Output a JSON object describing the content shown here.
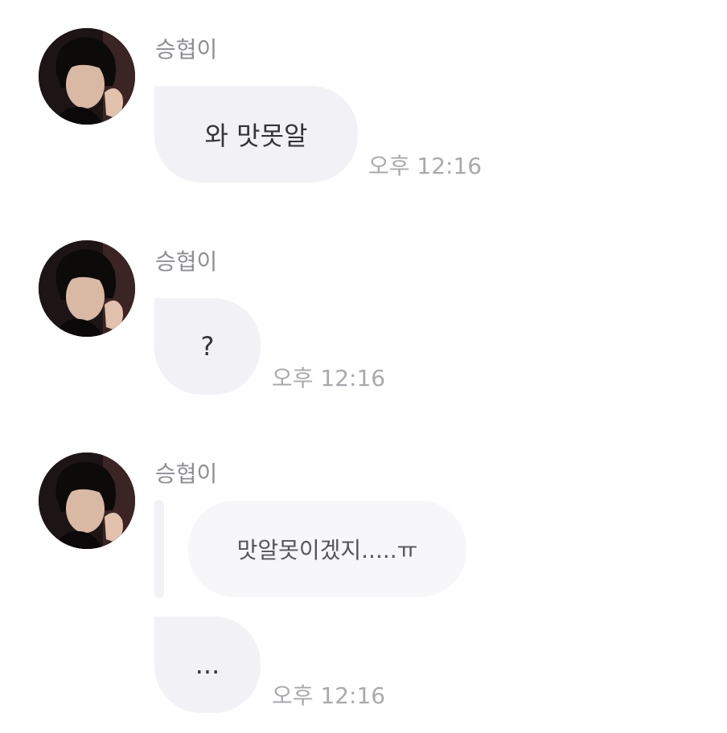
{
  "messages": [
    {
      "sender": "승협이",
      "text": "와 맛못알",
      "time": "오후 12:16"
    },
    {
      "sender": "승협이",
      "text": "?",
      "time": "오후 12:16"
    },
    {
      "sender": "승협이",
      "quoted_text": "맛알못이겠지.....ㅠ",
      "text": "...",
      "time": "오후 12:16"
    }
  ],
  "colors": {
    "bubble": "#f2f2f6",
    "quoted_bubble": "#f7f7f9",
    "sender_text": "#8e8e93",
    "timestamp_text": "#a9a9ae"
  }
}
